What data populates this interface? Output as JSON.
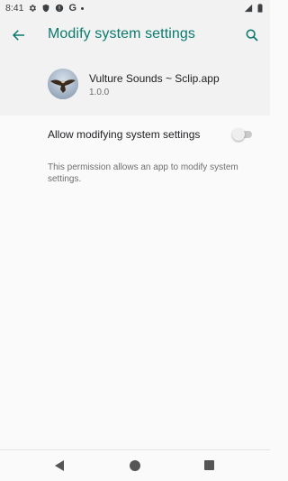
{
  "status_bar": {
    "time": "8:41",
    "google_letter": "G"
  },
  "app_bar": {
    "title": "Modify system settings"
  },
  "app": {
    "name": "Vulture Sounds ~ Sclip.app",
    "version": "1.0.0"
  },
  "toggle": {
    "label": "Allow modifying system settings",
    "enabled": false
  },
  "description": "This permission allows an app to modify system settings.",
  "colors": {
    "accent": "#0b7a6e",
    "background": "#fafafa",
    "header_background": "#f2f2f2"
  },
  "icons": {
    "back": "arrow-left-icon",
    "search": "search-icon",
    "settings": "gear-icon",
    "shield": "shield-icon",
    "alert": "alert-circle-icon",
    "wifi": "wifi-icon",
    "battery": "battery-icon"
  }
}
